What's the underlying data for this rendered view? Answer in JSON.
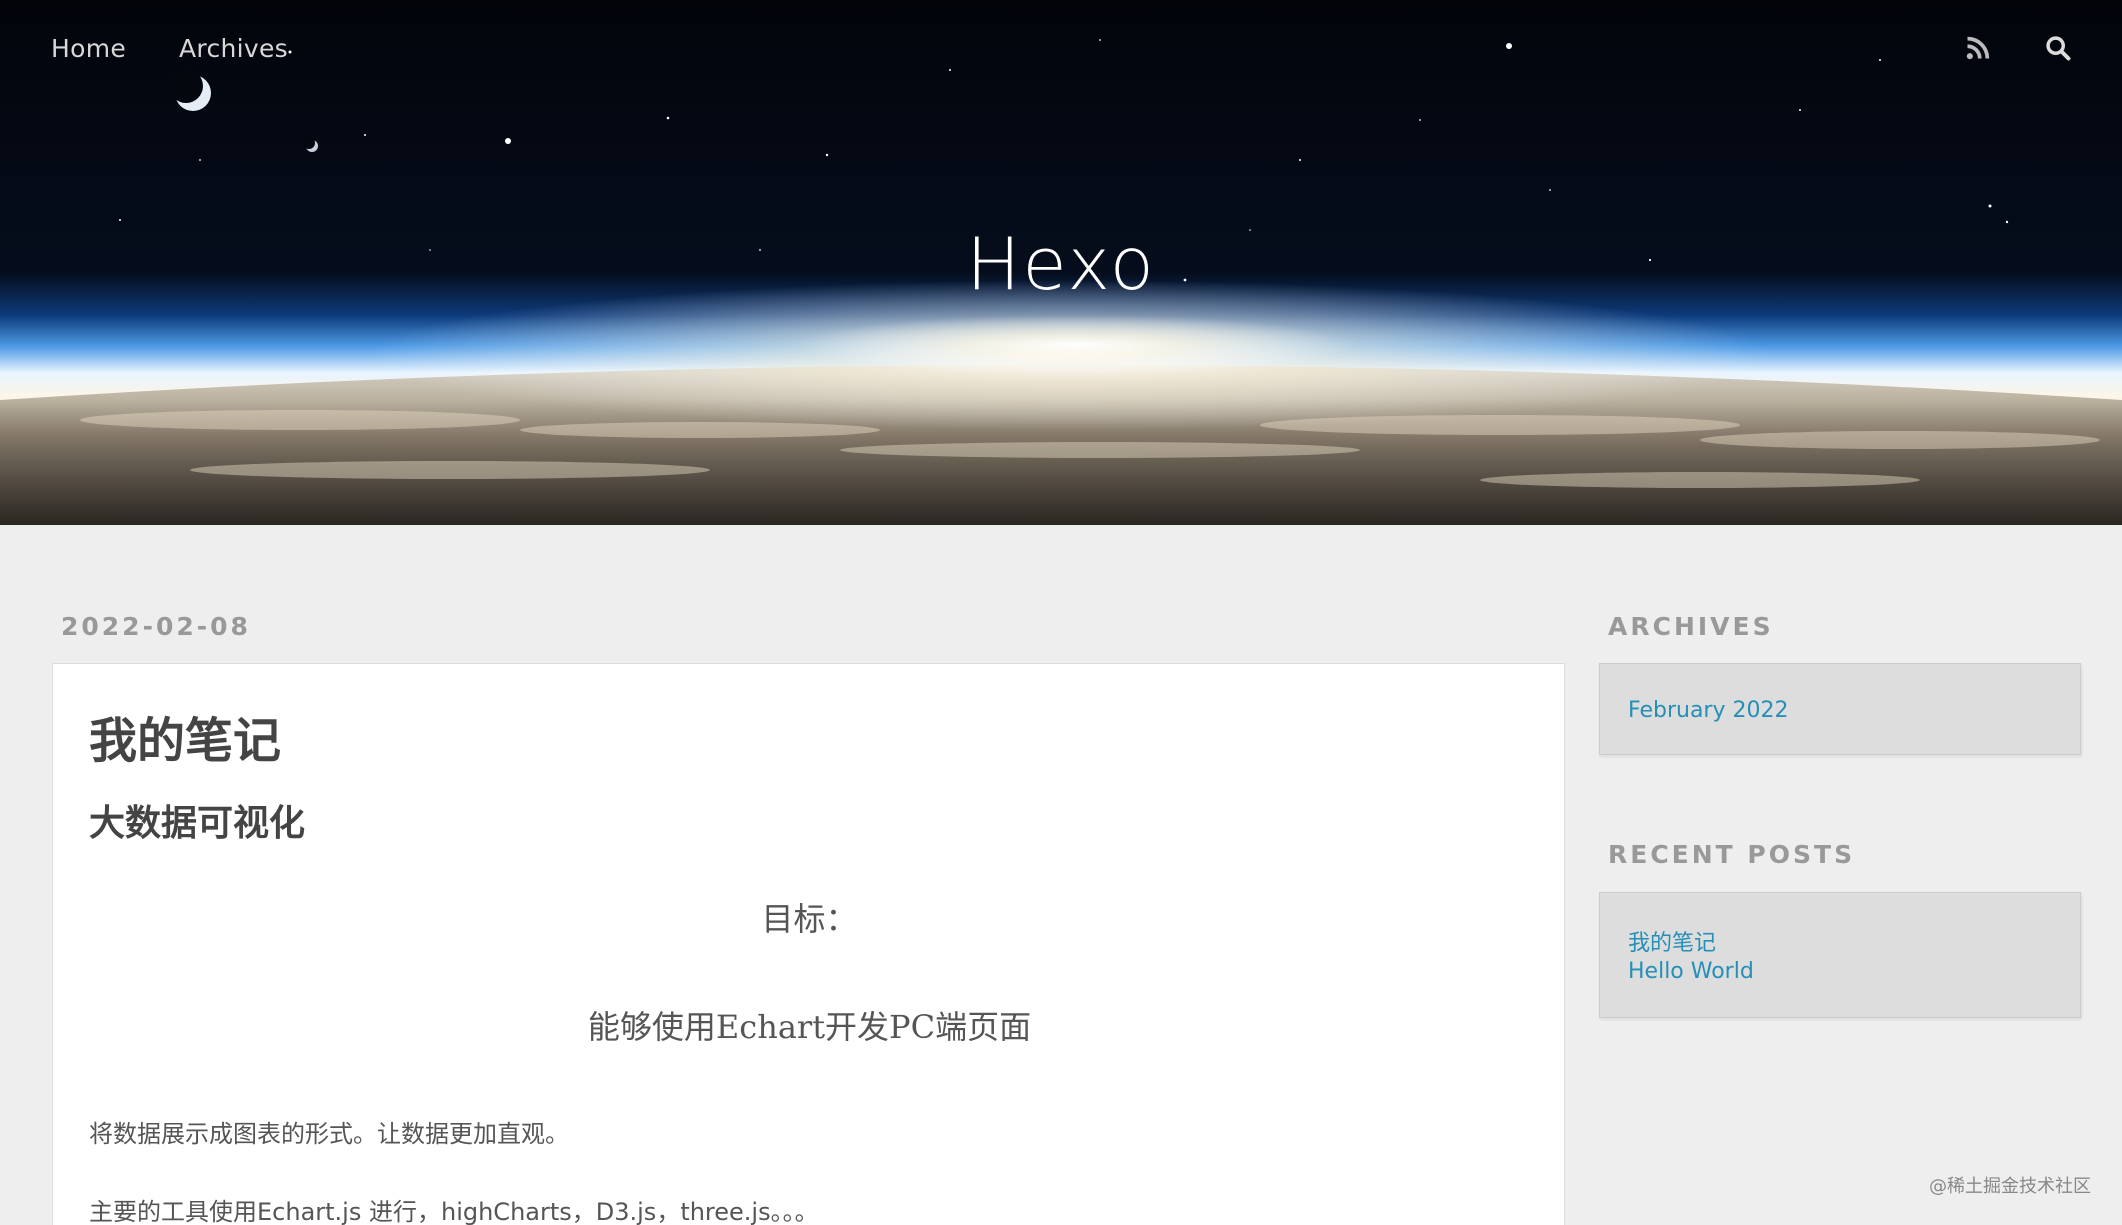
{
  "nav": {
    "home_label": "Home",
    "archives_label": "Archives",
    "rss_icon": "rss-icon",
    "search_icon": "search-icon"
  },
  "site": {
    "title": "Hexo"
  },
  "post": {
    "date": "2022-02-08",
    "title": "我的笔记",
    "heading": "大数据可视化",
    "goal_label": "目标：",
    "goal_text": "能够使用Echart开发PC端页面",
    "paragraph_1": "将数据展示成图表的形式。让数据更加直观。",
    "paragraph_2": "主要的工具使用Echart.js 进行，highCharts，D3.js，three.js。。。"
  },
  "sidebar": {
    "archives": {
      "title": "ARCHIVES",
      "items": [
        {
          "label": "February 2022"
        }
      ]
    },
    "recent_posts": {
      "title": "RECENT POSTS",
      "items": [
        {
          "label": "我的笔记"
        },
        {
          "label": "Hello World"
        }
      ]
    }
  },
  "watermark": "@稀土掘金技术社区",
  "colors": {
    "page_bg": "#eeeeee",
    "link": "#258fb8",
    "widget_bg": "#dddddd",
    "muted_heading": "#999999"
  }
}
